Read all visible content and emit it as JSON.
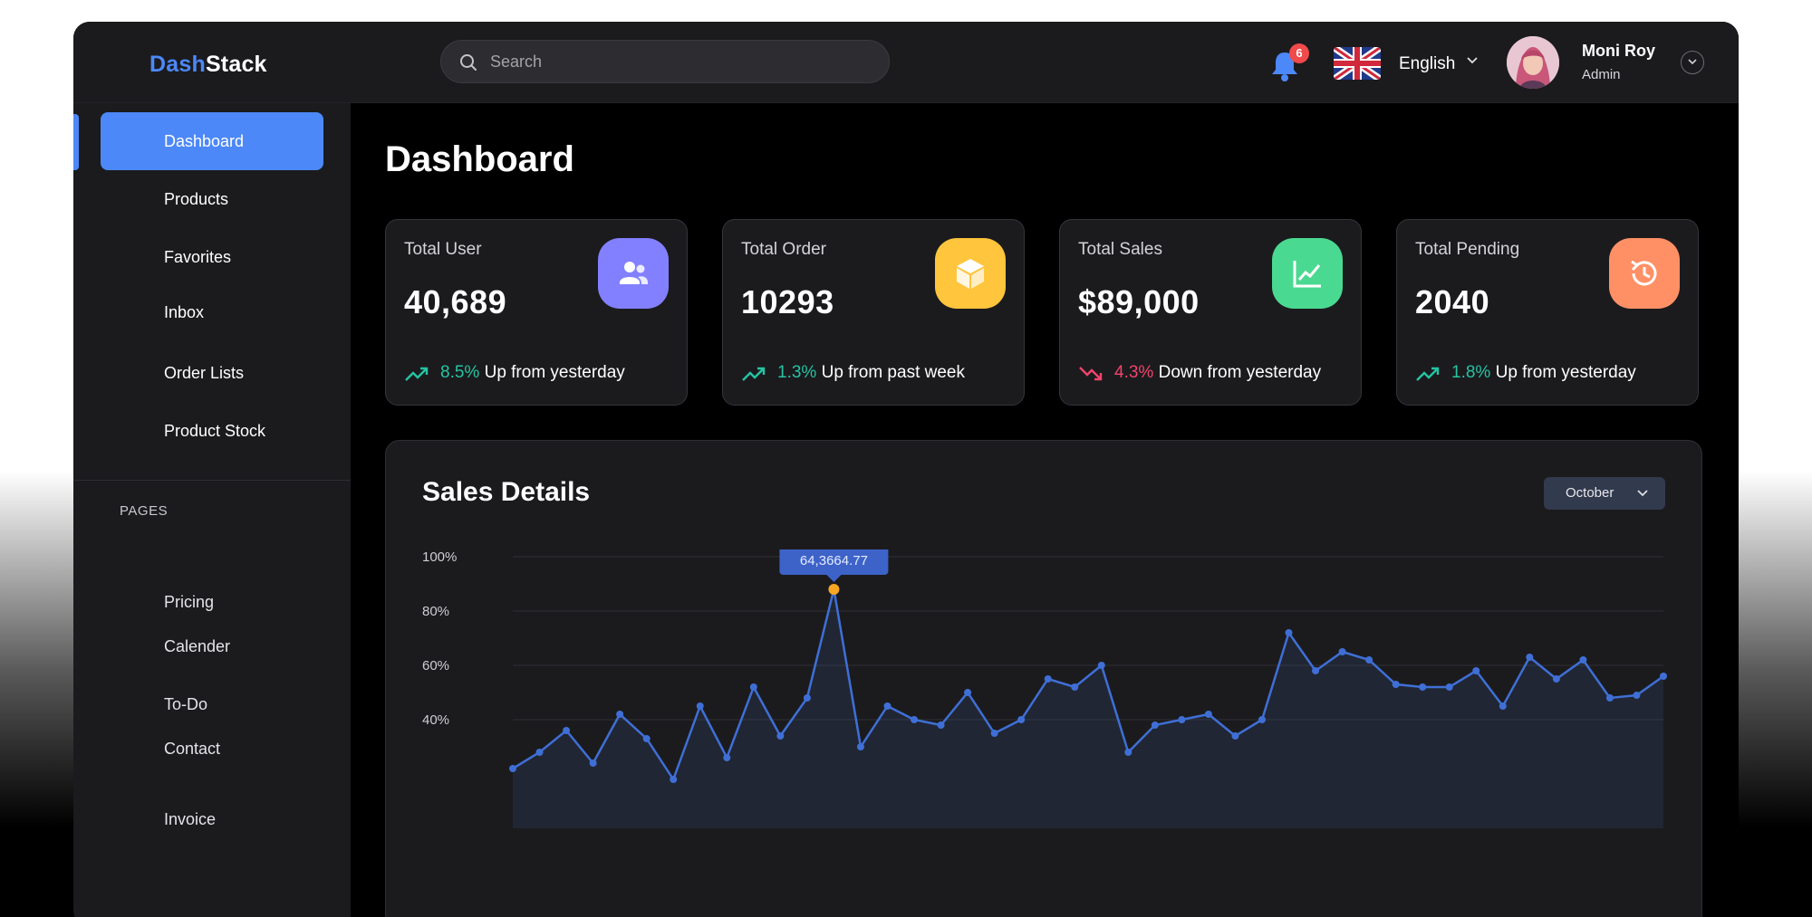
{
  "app": {
    "logo_accent": "Dash",
    "logo_rest": "Stack"
  },
  "header": {
    "search_placeholder": "Search",
    "notification_count": "6",
    "language": "English",
    "user": {
      "name": "Moni Roy",
      "role": "Admin"
    }
  },
  "sidebar": {
    "items": [
      {
        "label": "Dashboard",
        "active": true
      },
      {
        "label": "Products"
      },
      {
        "label": "Favorites"
      },
      {
        "label": "Inbox"
      },
      {
        "label": "Order Lists"
      },
      {
        "label": "Product Stock"
      }
    ],
    "pages_label": "PAGES",
    "pages": [
      {
        "label": "Pricing"
      },
      {
        "label": "Calender"
      },
      {
        "label": "To-Do"
      },
      {
        "label": "Contact"
      },
      {
        "label": "Invoice"
      }
    ]
  },
  "main": {
    "title": "Dashboard",
    "cards": [
      {
        "title": "Total User",
        "value": "40,689",
        "pct": "8.5%",
        "trend_text": " Up from yesterday",
        "direction": "up",
        "icon": "users-icon",
        "color": "#8280ff"
      },
      {
        "title": "Total Order",
        "value": "10293",
        "pct": "1.3%",
        "trend_text": " Up from past week",
        "direction": "up",
        "icon": "box-icon",
        "color": "#fec53d"
      },
      {
        "title": "Total Sales",
        "value": "$89,000",
        "pct": "4.3%",
        "trend_text": " Down from yesterday",
        "direction": "down",
        "icon": "line-chart-icon",
        "color": "#4ad991"
      },
      {
        "title": "Total Pending",
        "value": "2040",
        "pct": "1.8%",
        "trend_text": " Up from yesterday",
        "direction": "up",
        "icon": "history-icon",
        "color": "#ff9066"
      }
    ],
    "sales": {
      "title": "Sales Details",
      "month": "October"
    }
  },
  "chart_data": {
    "type": "line",
    "title": "Sales Details",
    "y_ticks": [
      "100%",
      "80%",
      "60%",
      "40%"
    ],
    "ylim": [
      0,
      100
    ],
    "tooltip": "64,3664.77",
    "series": [
      {
        "x": [
          0,
          1,
          2,
          3,
          4,
          5,
          6,
          7,
          8,
          9,
          10,
          11,
          12,
          13,
          14,
          15,
          16,
          17,
          18,
          19,
          20,
          21,
          22,
          23,
          24,
          25,
          26,
          27,
          28,
          29,
          30,
          31,
          32,
          33,
          34,
          35,
          36,
          37,
          38,
          39,
          40,
          41,
          42,
          43
        ],
        "values": [
          22,
          28,
          36,
          24,
          42,
          33,
          18,
          45,
          26,
          52,
          34,
          48,
          88,
          30,
          45,
          40,
          38,
          50,
          35,
          40,
          55,
          52,
          60,
          28,
          38,
          40,
          42,
          34,
          40,
          72,
          58,
          65,
          62,
          53,
          52,
          52,
          58,
          45,
          63,
          55,
          62,
          48,
          49,
          56
        ]
      }
    ]
  }
}
